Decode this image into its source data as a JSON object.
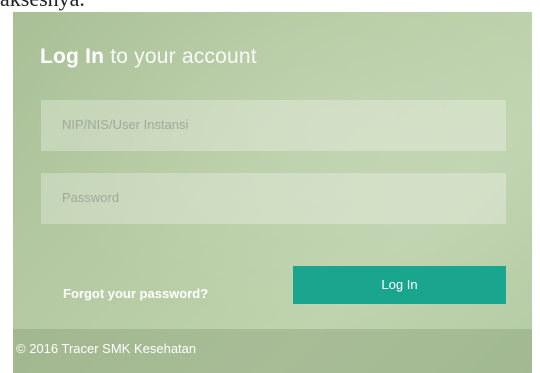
{
  "background_text": "aksesnya.",
  "login": {
    "title_bold": "Log In",
    "title_rest": " to your account",
    "username_placeholder": "NIP/NIS/User Instansi",
    "password_placeholder": "Password",
    "forgot_label": "Forgot your password?",
    "login_label": "Log In"
  },
  "footer": {
    "copyright": "© 2016 Tracer SMK Kesehatan"
  },
  "colors": {
    "panel_background": "#b6cba3",
    "button": "#1aa58e",
    "text": "#ffffff"
  }
}
